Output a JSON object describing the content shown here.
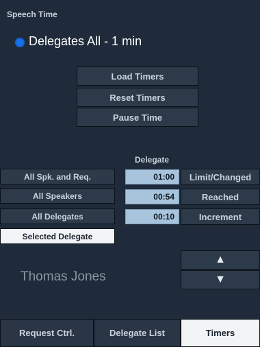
{
  "section_title": "Speech Time",
  "status": {
    "label": "Delegates All - 1 min",
    "dot_color": "#1a73e8"
  },
  "timer_buttons": [
    "Load Timers",
    "Reset Timers",
    "Pause Time"
  ],
  "delegate_header": "Delegate",
  "speaker_modes": [
    {
      "label": "All Spk. and Req.",
      "selected": false
    },
    {
      "label": "All Speakers",
      "selected": false
    },
    {
      "label": "All Delegates",
      "selected": false
    },
    {
      "label": "Selected Delegate",
      "selected": true
    }
  ],
  "times": [
    "01:00",
    "00:54",
    "00:10"
  ],
  "time_labels": [
    "Limit/Changed",
    "Reached",
    "Increment"
  ],
  "speaker_name": "Thomas Jones",
  "arrows": {
    "up": "▲",
    "down": "▼"
  },
  "tabs": [
    {
      "label": "Request Ctrl.",
      "active": false
    },
    {
      "label": "Delegate List",
      "active": false
    },
    {
      "label": "Timers",
      "active": true
    }
  ]
}
